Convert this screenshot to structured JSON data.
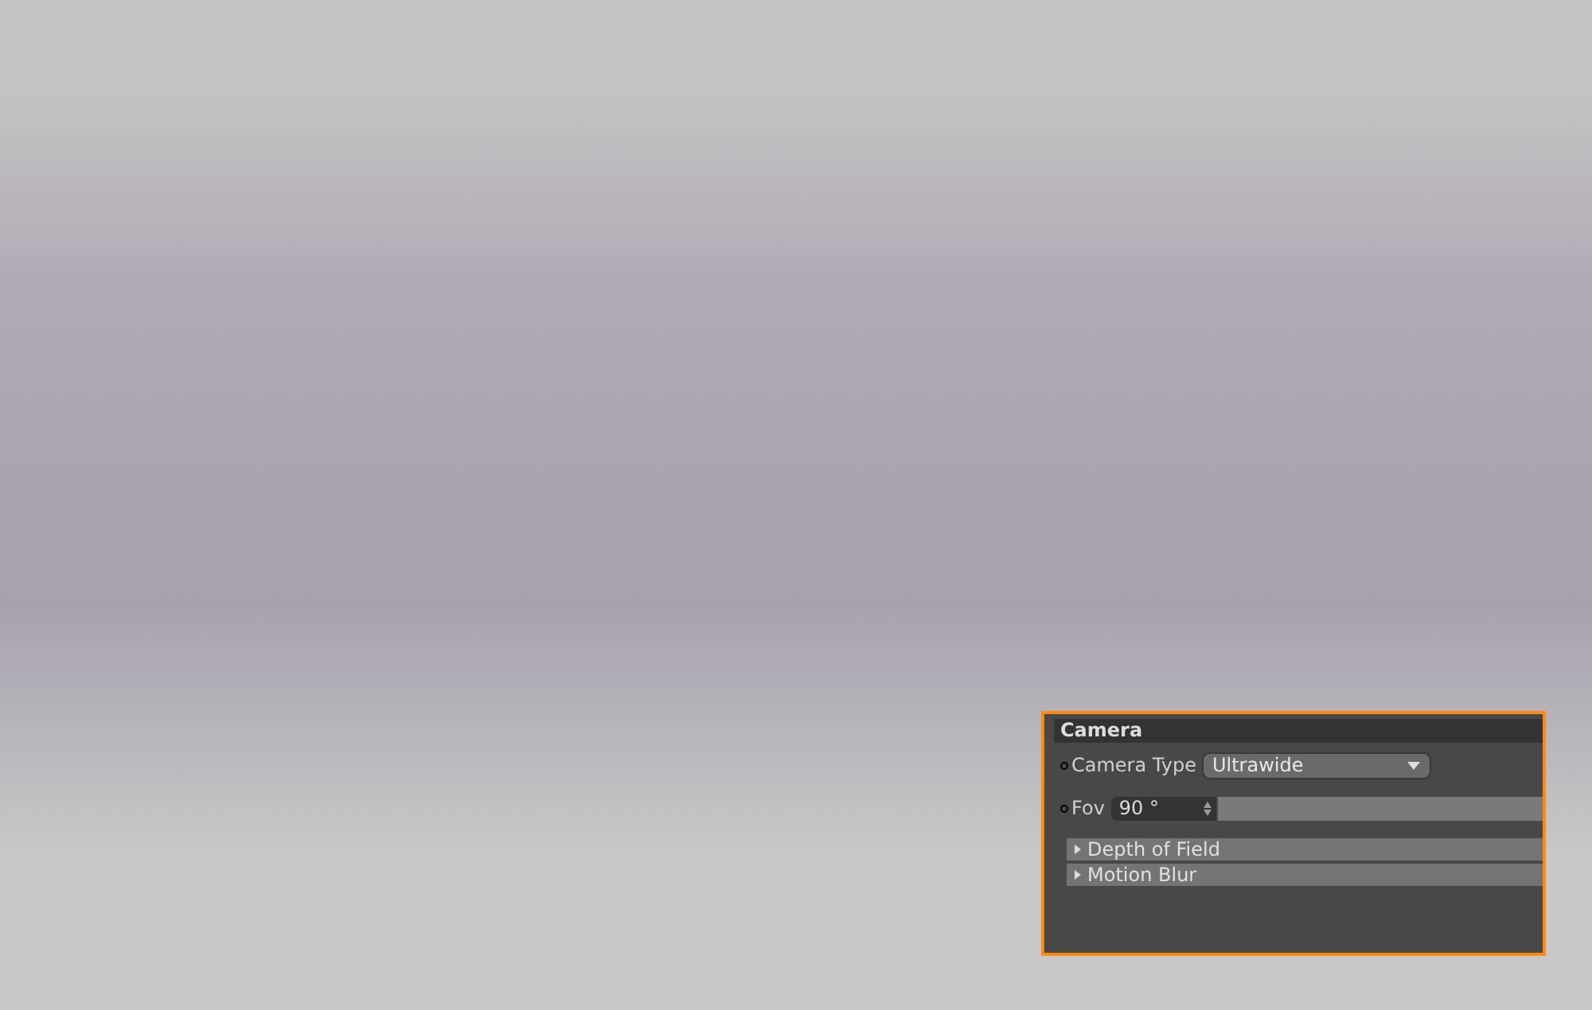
{
  "panel": {
    "title": "Camera",
    "fields": [
      {
        "kind": "dropdown",
        "label": "Camera Type",
        "value": "Ultrawide"
      },
      {
        "kind": "slider",
        "label": "Fov",
        "value": "90 °"
      }
    ],
    "sections": [
      {
        "label": "Depth of Field",
        "expanded": false
      },
      {
        "label": "Motion Blur",
        "expanded": false
      }
    ]
  }
}
